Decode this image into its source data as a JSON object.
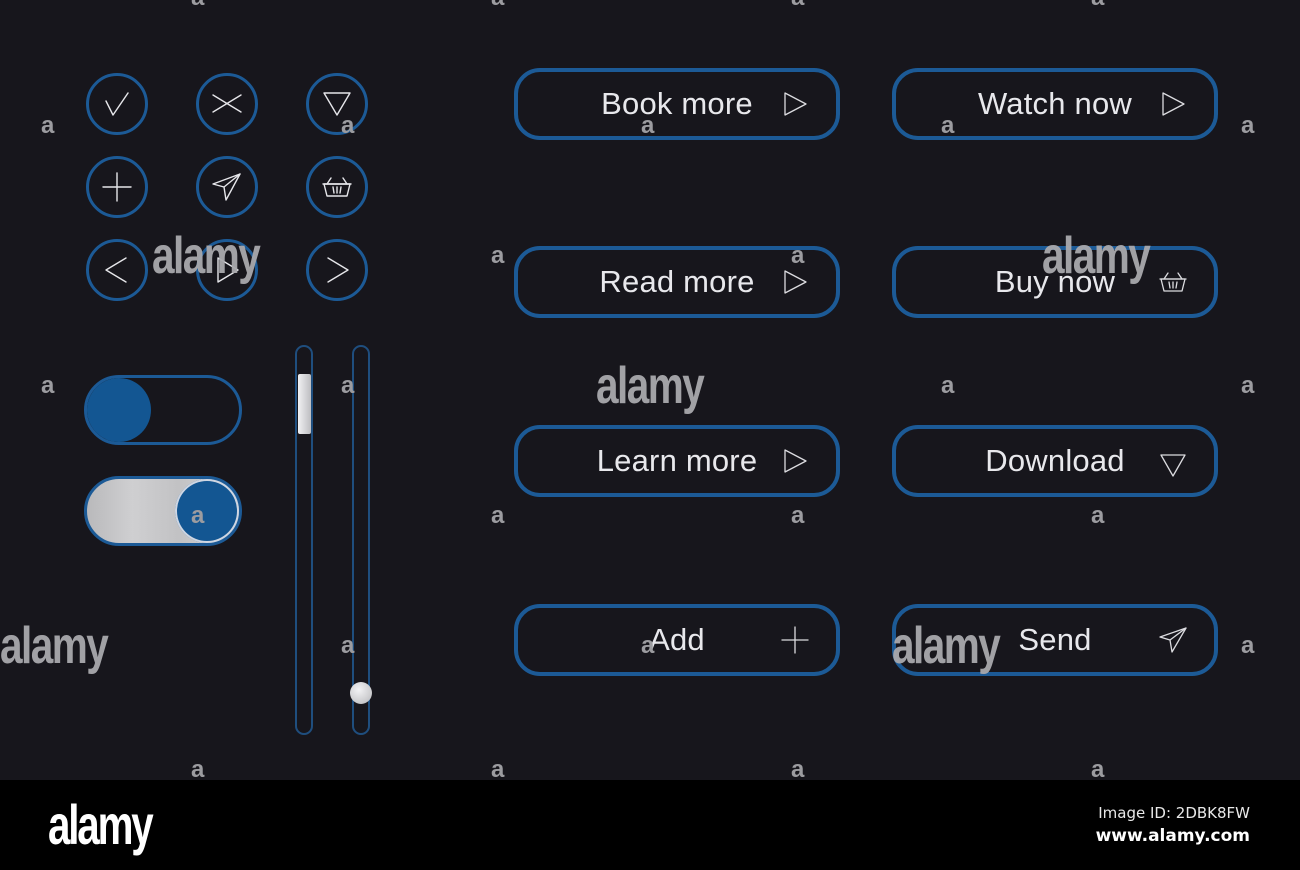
{
  "icon_buttons": [
    {
      "name": "check",
      "icon": "check-icon"
    },
    {
      "name": "close",
      "icon": "close-icon"
    },
    {
      "name": "down",
      "icon": "triangle-down-icon"
    },
    {
      "name": "add",
      "icon": "plus-icon"
    },
    {
      "name": "send",
      "icon": "paper-plane-icon"
    },
    {
      "name": "basket",
      "icon": "basket-icon"
    },
    {
      "name": "previous",
      "icon": "chevron-left-icon"
    },
    {
      "name": "play",
      "icon": "play-icon"
    },
    {
      "name": "next",
      "icon": "chevron-right-icon"
    }
  ],
  "toggles": [
    {
      "state": "off"
    },
    {
      "state": "on"
    }
  ],
  "sliders": [
    {
      "style": "rect-thumb",
      "value_fraction_from_top": 0.09
    },
    {
      "style": "round-thumb",
      "value_fraction_from_top": 0.89
    }
  ],
  "buttons": {
    "book_more": {
      "label": "Book more",
      "icon": "play-icon"
    },
    "watch_now": {
      "label": "Watch now",
      "icon": "play-icon"
    },
    "read_more": {
      "label": "Read more",
      "icon": "play-icon"
    },
    "buy_now": {
      "label": "Buy now",
      "icon": "basket-icon"
    },
    "learn_more": {
      "label": "Learn more",
      "icon": "play-icon"
    },
    "download": {
      "label": "Download",
      "icon": "triangle-down-icon"
    },
    "add": {
      "label": "Add",
      "icon": "plus-icon"
    },
    "send": {
      "label": "Send",
      "icon": "paper-plane-icon"
    }
  },
  "colors": {
    "background": "#17161c",
    "accent": "#1c5a96",
    "text": "#e8e8ec"
  },
  "watermark": {
    "brand": "alamy",
    "letter": "a",
    "image_id": "Image ID: 2DBK8FW",
    "site": "www.alamy.com"
  }
}
